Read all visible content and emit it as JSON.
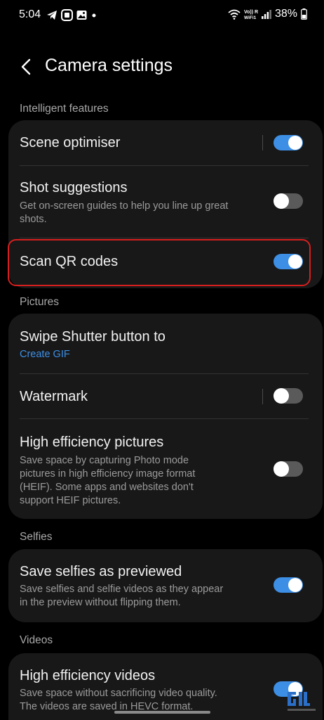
{
  "status_bar": {
    "time": "5:04",
    "battery": "38%",
    "icons_left": [
      "telegram-icon",
      "app-icon",
      "gallery-icon",
      "dot-icon"
    ],
    "icons_right": [
      "wifi-icon",
      "volte-icon",
      "signal-icon",
      "battery-icon"
    ]
  },
  "header": {
    "title": "Camera settings"
  },
  "sections": {
    "intelligent": {
      "label": "Intelligent features",
      "scene": {
        "title": "Scene optimiser",
        "toggle": "on"
      },
      "shot": {
        "title": "Shot suggestions",
        "sub1": "Get on-screen guides to help you line up great",
        "sub2": "shots.",
        "toggle": "off"
      },
      "qr": {
        "title": "Scan QR codes",
        "toggle": "on"
      }
    },
    "pictures": {
      "label": "Pictures",
      "swipe": {
        "title": "Swipe Shutter button to",
        "value": "Create GIF"
      },
      "watermark": {
        "title": "Watermark",
        "toggle": "off"
      },
      "heif": {
        "title": "High efficiency pictures",
        "sub1": "Save space by capturing Photo mode",
        "sub2": "pictures in high efficiency image format",
        "sub3": "(HEIF). Some apps and websites don't",
        "sub4": "support HEIF pictures.",
        "toggle": "off"
      }
    },
    "selfies": {
      "label": "Selfies",
      "preview": {
        "title": "Save selfies as previewed",
        "sub1": "Save selfies and selfie videos as they appear",
        "sub2": "in the preview without flipping them.",
        "toggle": "on"
      }
    },
    "videos": {
      "label": "Videos",
      "hevc": {
        "title": "High efficiency videos",
        "sub1": "Save space without sacrificing video quality.",
        "sub2": "The videos are saved in HEVC format.",
        "toggle": "on"
      }
    }
  },
  "colors": {
    "accent": "#3d8fe5",
    "highlight": "#d71f1f",
    "card_bg": "#181818"
  }
}
